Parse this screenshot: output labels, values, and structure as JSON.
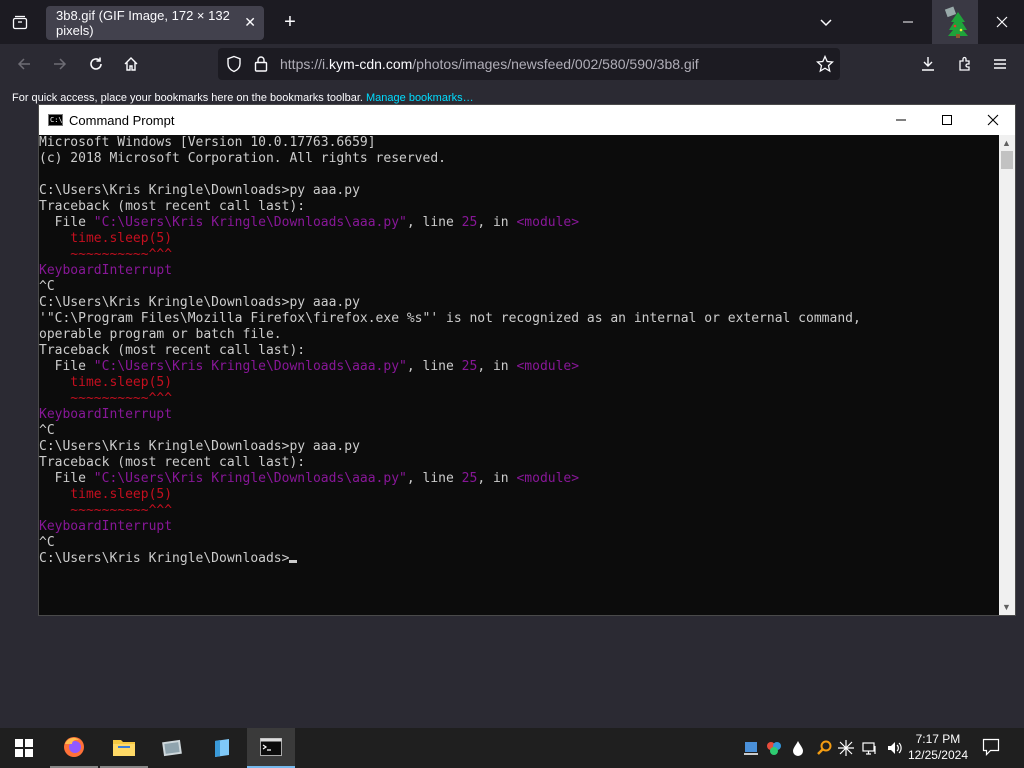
{
  "browser": {
    "tab_title": "3b8.gif (GIF Image, 172 × 132 pixels)",
    "tab_close": "✕",
    "new_tab": "+",
    "url_prefix": "https://i.",
    "url_domain": "kym-cdn.com",
    "url_path": "/photos/images/newsfeed/002/580/590/3b8.gif",
    "bookmarks_text": "For quick access, place your bookmarks here on the bookmarks toolbar.",
    "bookmarks_link": "Manage bookmarks…",
    "icons": [
      "tab-list-icon",
      "back-icon",
      "forward-icon",
      "reload-icon",
      "home-icon",
      "shield-icon",
      "lock-icon",
      "star-icon",
      "download-icon",
      "extensions-icon",
      "menu-icon"
    ]
  },
  "cmd": {
    "title": "Command Prompt",
    "lines": [
      [
        {
          "t": "Microsoft Windows [Version 10.0.17763.6659]",
          "c": ""
        }
      ],
      [
        {
          "t": "(c) 2018 Microsoft Corporation. All rights reserved.",
          "c": ""
        }
      ],
      [
        {
          "t": "",
          "c": ""
        }
      ],
      [
        {
          "t": "C:\\Users\\Kris Kringle\\Downloads>py aaa.py",
          "c": ""
        }
      ],
      [
        {
          "t": "Traceback (most recent call last):",
          "c": ""
        }
      ],
      [
        {
          "t": "  File ",
          "c": ""
        },
        {
          "t": "\"C:\\Users\\Kris Kringle\\Downloads\\aaa.py\"",
          "c": "purple"
        },
        {
          "t": ", line ",
          "c": ""
        },
        {
          "t": "25",
          "c": "purple"
        },
        {
          "t": ", in ",
          "c": ""
        },
        {
          "t": "<module>",
          "c": "purple"
        }
      ],
      [
        {
          "t": "    time.sleep(5)",
          "c": "red"
        }
      ],
      [
        {
          "t": "    ~~~~~~~~~~^^^",
          "c": "red"
        }
      ],
      [
        {
          "t": "KeyboardInterrupt",
          "c": "purple"
        }
      ],
      [
        {
          "t": "^C",
          "c": ""
        }
      ],
      [
        {
          "t": "C:\\Users\\Kris Kringle\\Downloads>py aaa.py",
          "c": ""
        }
      ],
      [
        {
          "t": "'\"C:\\Program Files\\Mozilla Firefox\\firefox.exe %s\"' is not recognized as an internal or external command,",
          "c": ""
        }
      ],
      [
        {
          "t": "operable program or batch file.",
          "c": ""
        }
      ],
      [
        {
          "t": "Traceback (most recent call last):",
          "c": ""
        }
      ],
      [
        {
          "t": "  File ",
          "c": ""
        },
        {
          "t": "\"C:\\Users\\Kris Kringle\\Downloads\\aaa.py\"",
          "c": "purple"
        },
        {
          "t": ", line ",
          "c": ""
        },
        {
          "t": "25",
          "c": "purple"
        },
        {
          "t": ", in ",
          "c": ""
        },
        {
          "t": "<module>",
          "c": "purple"
        }
      ],
      [
        {
          "t": "    time.sleep(5)",
          "c": "red"
        }
      ],
      [
        {
          "t": "    ~~~~~~~~~~^^^",
          "c": "red"
        }
      ],
      [
        {
          "t": "KeyboardInterrupt",
          "c": "purple"
        }
      ],
      [
        {
          "t": "^C",
          "c": ""
        }
      ],
      [
        {
          "t": "C:\\Users\\Kris Kringle\\Downloads>py aaa.py",
          "c": ""
        }
      ],
      [
        {
          "t": "Traceback (most recent call last):",
          "c": ""
        }
      ],
      [
        {
          "t": "  File ",
          "c": ""
        },
        {
          "t": "\"C:\\Users\\Kris Kringle\\Downloads\\aaa.py\"",
          "c": "purple"
        },
        {
          "t": ", line ",
          "c": ""
        },
        {
          "t": "25",
          "c": "purple"
        },
        {
          "t": ", in ",
          "c": ""
        },
        {
          "t": "<module>",
          "c": "purple"
        }
      ],
      [
        {
          "t": "    time.sleep(5)",
          "c": "red"
        }
      ],
      [
        {
          "t": "    ~~~~~~~~~~^^^",
          "c": "red"
        }
      ],
      [
        {
          "t": "KeyboardInterrupt",
          "c": "purple"
        }
      ],
      [
        {
          "t": "^C",
          "c": ""
        }
      ],
      [
        {
          "t": "C:\\Users\\Kris Kringle\\Downloads>",
          "c": "",
          "cursor": true
        }
      ]
    ],
    "colors": {
      "background": "#0c0c0c",
      "text": "#cccccc",
      "purple": "#881798",
      "red": "#c50f1f"
    }
  },
  "taskbar": {
    "time": "7:17 PM",
    "date": "12/25/2024",
    "apps": [
      "start-icon",
      "firefox-icon",
      "file-explorer-icon",
      "app-icon-1",
      "app-icon-2",
      "command-prompt-icon"
    ]
  }
}
